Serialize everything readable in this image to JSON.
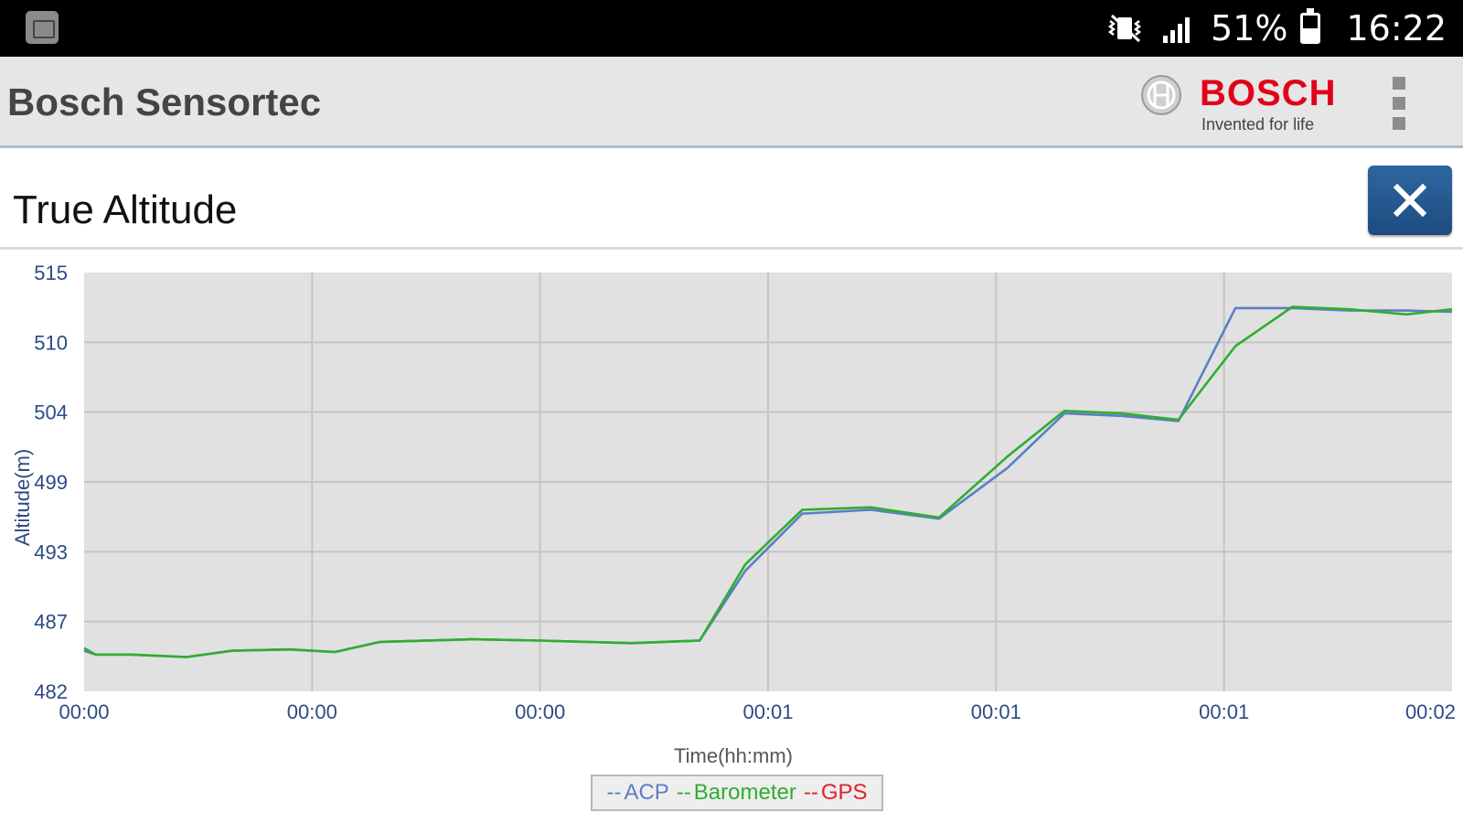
{
  "status_bar": {
    "app_icon": "app-icon",
    "mute_icon": "vibrate-mute-icon",
    "signal_icon": "signal-icon",
    "battery_text": "51%",
    "battery_level": 0.51,
    "time": "16:22"
  },
  "app_bar": {
    "title": "Bosch Sensortec",
    "brand": "BOSCH",
    "tagline": "Invented for life",
    "menu_icon": "overflow-menu-icon"
  },
  "page": {
    "title": "True Altitude",
    "close_icon": "close-icon"
  },
  "colors": {
    "accent": "#1f5189",
    "acp": "#5b7fc4",
    "barometer": "#2fae2f",
    "gps": "#e0232a",
    "plot_bg": "#e1e1e1",
    "grid": "#c4c4c4",
    "tick_text": "#2d4a84"
  },
  "chart_data": {
    "type": "line",
    "xlabel": "Time(hh:mm)",
    "ylabel": "Altitude(m)",
    "x_tick_labels": [
      "00:00",
      "00:00",
      "00:00",
      "00:01",
      "00:01",
      "00:01",
      "00:02"
    ],
    "y_tick_labels": [
      "515",
      "510",
      "504",
      "499",
      "493",
      "487",
      "482"
    ],
    "ylim": [
      482,
      515
    ],
    "xlim": [
      0,
      120
    ],
    "grid": true,
    "legend_position": "bottom-center",
    "series": [
      {
        "name": "ACP",
        "color": "#5b7fc4",
        "x": [
          0,
          1,
          4,
          9,
          13,
          18,
          22,
          26,
          34,
          40,
          48,
          54,
          58,
          63,
          69,
          75,
          81,
          86,
          91,
          96,
          101,
          106,
          111,
          116,
          120
        ],
        "y": [
          485.2,
          484.9,
          484.9,
          484.7,
          485.2,
          485.3,
          485.1,
          485.9,
          486.1,
          486.0,
          485.8,
          486.0,
          491.5,
          496.0,
          496.3,
          495.6,
          499.6,
          503.9,
          503.7,
          503.3,
          512.2,
          512.2,
          512.0,
          512.0,
          511.9
        ]
      },
      {
        "name": "Barometer",
        "color": "#2fae2f",
        "x": [
          0,
          1,
          4,
          9,
          13,
          18,
          22,
          26,
          34,
          40,
          48,
          54,
          58,
          63,
          69,
          75,
          81,
          86,
          91,
          96,
          101,
          106,
          111,
          116,
          120
        ],
        "y": [
          485.4,
          484.9,
          484.9,
          484.7,
          485.2,
          485.3,
          485.1,
          485.9,
          486.1,
          486.0,
          485.8,
          486.0,
          492.0,
          496.3,
          496.5,
          495.7,
          500.5,
          504.1,
          503.9,
          503.4,
          509.2,
          512.3,
          512.1,
          511.7,
          512.1
        ]
      },
      {
        "name": "GPS",
        "color": "#e0232a",
        "x": [],
        "y": []
      }
    ]
  }
}
